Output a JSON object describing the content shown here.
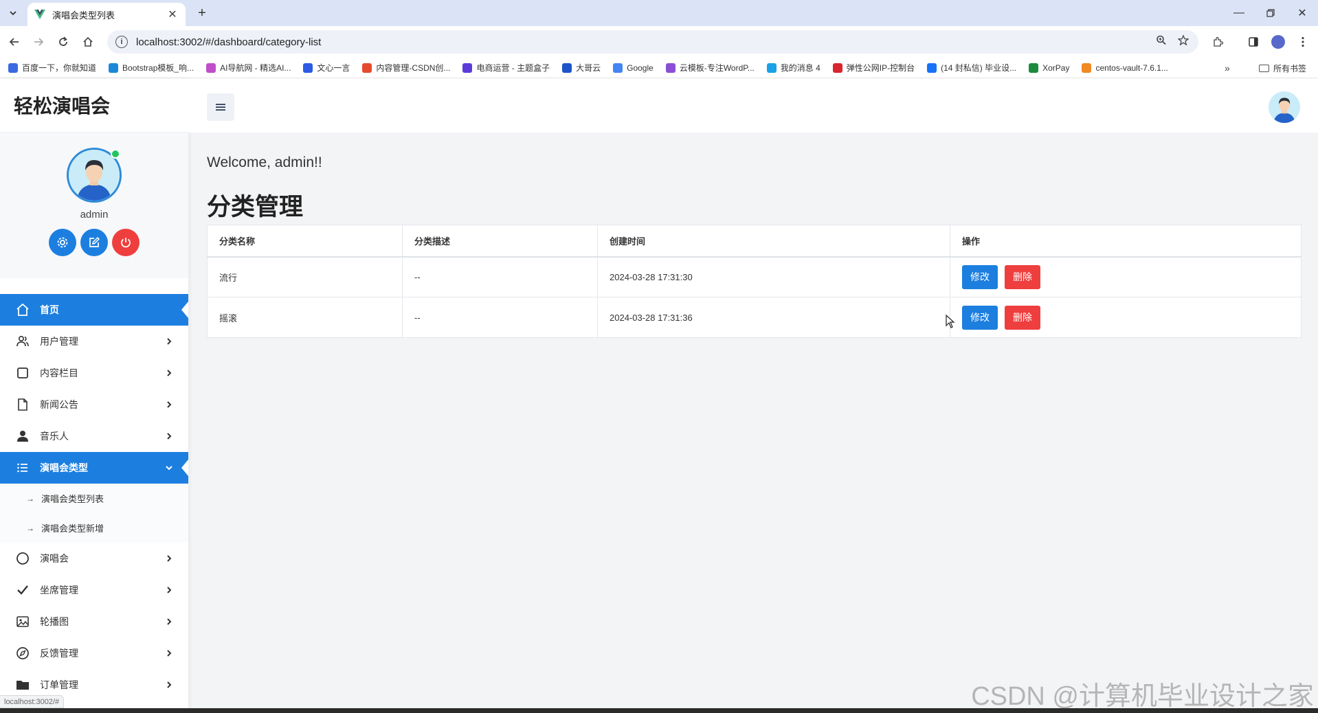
{
  "browser": {
    "tab_title": "演唱会类型列表",
    "url": "localhost:3002/#/dashboard/category-list",
    "bookmarks": [
      {
        "label": "百度一下，你就知道",
        "color": "#3b6ae0"
      },
      {
        "label": "Bootstrap模板_响...",
        "color": "#1a88d8"
      },
      {
        "label": "AI导航网 - 精选AI...",
        "color": "#c04ec9"
      },
      {
        "label": "文心一言",
        "color": "#2d5be3"
      },
      {
        "label": "内容管理-CSDN创...",
        "color": "#e64a2e"
      },
      {
        "label": "电商运营 - 主题盒子",
        "color": "#5b3bd8"
      },
      {
        "label": "大哥云",
        "color": "#1f53c9"
      },
      {
        "label": "Google",
        "color": "#4285f4"
      },
      {
        "label": "云模板-专注WordP...",
        "color": "#8b4fd6"
      },
      {
        "label": "我的消息 4",
        "color": "#1aa1e6"
      },
      {
        "label": "弹性公网IP-控制台",
        "color": "#d9252e"
      },
      {
        "label": "(14 封私信) 毕业设...",
        "color": "#1772f6"
      },
      {
        "label": "XorPay",
        "color": "#1b8a3c"
      },
      {
        "label": "centos-vault-7.6.1...",
        "color": "#f08a24"
      }
    ],
    "bookmarks_folder": "所有书签",
    "status_url": "localhost:3002/#"
  },
  "sidebar": {
    "brand": "轻松演唱会",
    "username": "admin",
    "menu": [
      {
        "label": "首页",
        "icon": "home-icon",
        "active": true,
        "chevron": false
      },
      {
        "label": "用户管理",
        "icon": "users-icon",
        "active": false,
        "chevron": true
      },
      {
        "label": "内容栏目",
        "icon": "square-icon",
        "active": false,
        "chevron": true
      },
      {
        "label": "新闻公告",
        "icon": "file-icon",
        "active": false,
        "chevron": true
      },
      {
        "label": "音乐人",
        "icon": "person-icon",
        "active": false,
        "chevron": true
      },
      {
        "label": "演唱会类型",
        "icon": "list-icon",
        "active": true,
        "chevron": true,
        "expanded": true
      },
      {
        "label": "演唱会",
        "icon": "circle-icon",
        "active": false,
        "chevron": true
      },
      {
        "label": "坐席管理",
        "icon": "check-icon",
        "active": false,
        "chevron": true
      },
      {
        "label": "轮播图",
        "icon": "image-icon",
        "active": false,
        "chevron": true
      },
      {
        "label": "反馈管理",
        "icon": "compass-icon",
        "active": false,
        "chevron": true
      },
      {
        "label": "订单管理",
        "icon": "folder-icon",
        "active": false,
        "chevron": true
      }
    ],
    "submenu": [
      "演唱会类型列表",
      "演唱会类型新增"
    ]
  },
  "main": {
    "welcome": "Welcome, admin!!",
    "title": "分类管理",
    "table": {
      "headers": [
        "分类名称",
        "分类描述",
        "创建时间",
        "操作"
      ],
      "rows": [
        {
          "name": "流行",
          "desc": "--",
          "created": "2024-03-28 17:31:30"
        },
        {
          "name": "摇滚",
          "desc": "--",
          "created": "2024-03-28 17:31:36"
        }
      ],
      "edit_label": "修改",
      "delete_label": "删除"
    }
  },
  "watermark": "CSDN @计算机毕业设计之家",
  "colors": {
    "primary": "#1c7fe0",
    "danger": "#ef3e3e",
    "online": "#22c55e"
  }
}
